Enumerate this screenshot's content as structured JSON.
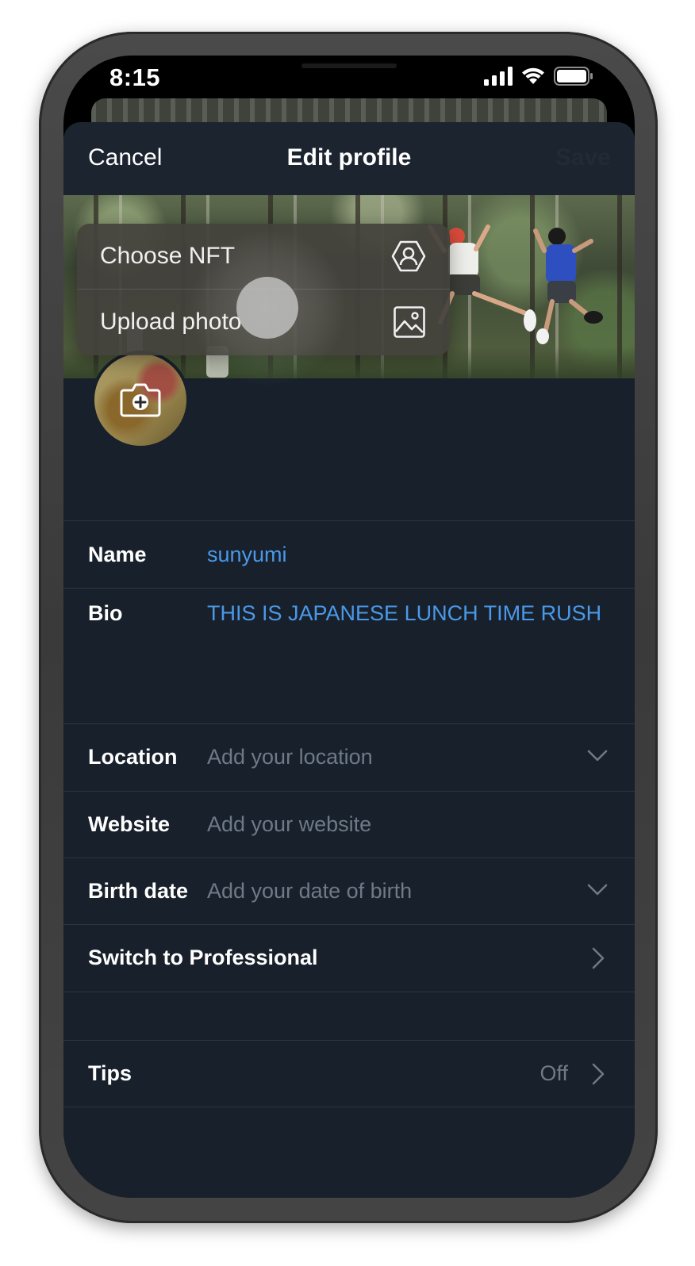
{
  "status_bar": {
    "time": "8:15"
  },
  "nav": {
    "cancel_label": "Cancel",
    "title": "Edit profile",
    "save_label": "Save"
  },
  "popover": {
    "items": [
      {
        "label": "Choose NFT",
        "icon": "nft-hexagon-icon"
      },
      {
        "label": "Upload photo",
        "icon": "image-icon"
      }
    ]
  },
  "profile": {
    "avatar_icon": "camera-plus-icon",
    "fields": {
      "name": {
        "label": "Name",
        "value": "sunyumi"
      },
      "bio": {
        "label": "Bio",
        "value": "THIS IS JAPANESE LUNCH TIME RUSH"
      },
      "location": {
        "label": "Location",
        "placeholder": "Add your location"
      },
      "website": {
        "label": "Website",
        "placeholder": "Add your website"
      },
      "birth_date": {
        "label": "Birth date",
        "placeholder": "Add your date of birth"
      }
    },
    "switch_professional": {
      "label": "Switch to Professional"
    },
    "tips": {
      "label": "Tips",
      "value": "Off"
    }
  },
  "colors": {
    "accent": "#4a99e9",
    "background": "#18202b",
    "muted_text": "#6f7a86"
  }
}
